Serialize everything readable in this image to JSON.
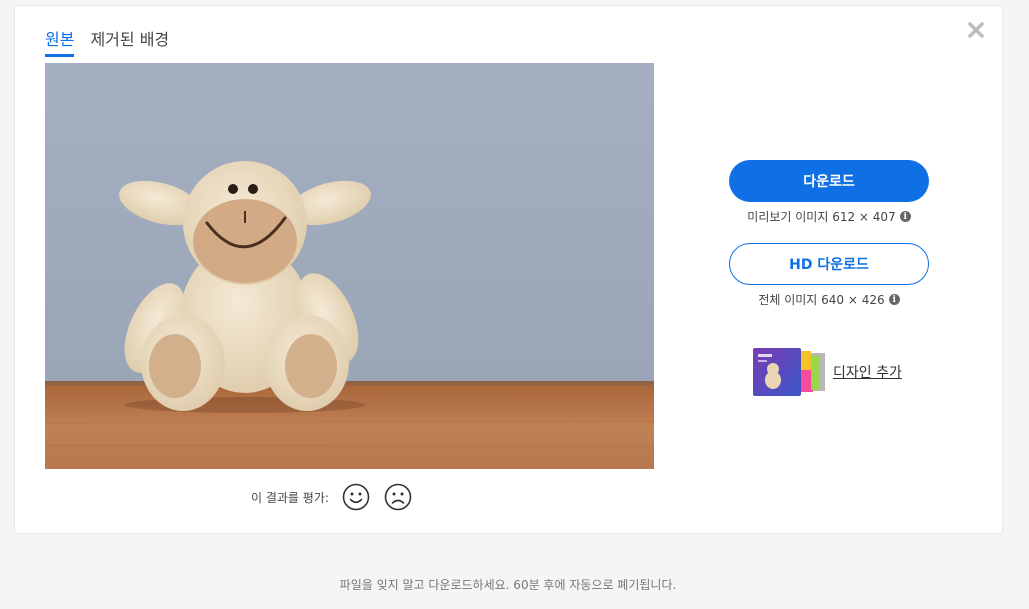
{
  "tabs": [
    {
      "label": "원본",
      "active": true
    },
    {
      "label": "제거된 배경",
      "active": false
    }
  ],
  "icons": {
    "close": "close-icon",
    "smile": "smile-icon",
    "frown": "frown-icon",
    "info": "info-icon"
  },
  "rating": {
    "prompt": "이 결과를 평가:"
  },
  "download": {
    "label": "다운로드",
    "info": "미리보기 이미지 612 × 407"
  },
  "hd_download": {
    "label": "HD 다운로드",
    "info": "전체 이미지 640 × 426"
  },
  "design": {
    "link": "디자인 추가"
  },
  "footer": {
    "notice": "파일을 잊지 말고 다운로드하세요. 60분 후에 자동으로 폐기됩니다."
  },
  "colors": {
    "accent": "#0f70e6",
    "background": "#f4f5f7"
  }
}
